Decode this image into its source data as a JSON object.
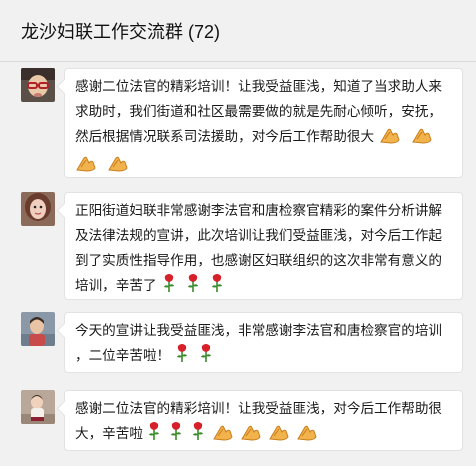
{
  "header": {
    "title": "龙沙妇联工作交流群 (72)"
  },
  "icons": {
    "clap": "clapping-hands-icon",
    "rose": "rose-icon"
  },
  "messages": [
    {
      "lines": [
        "感谢二位法官的精彩培训！让我受益匪浅，知道了当求助人来",
        "求助时，我们街道和社区最需要做的就是先耐心倾听，安抚，",
        "然后根据情况联系司法援助，对今后工作帮助很大"
      ],
      "emoji_line3": [
        "clap",
        "clap"
      ],
      "emoji_line4": [
        "clap",
        "clap"
      ]
    },
    {
      "lines": [
        "正阳街道妇联非常感谢李法官和唐检察官精彩的案件分析讲解",
        "及法律法规的宣讲，此次培训让我们受益匪浅，对今后工作起",
        "到了实质性指导作用，也感谢区妇联组织的这次非常有意义的",
        "培训，辛苦了"
      ],
      "emoji_line4": [
        "rose",
        "rose",
        "rose"
      ]
    },
    {
      "lines": [
        "今天的宣讲让我受益匪浅，非常感谢李法官和唐检察官的培训",
        "，二位辛苦啦！"
      ],
      "emoji_line2": [
        "rose",
        "rose"
      ]
    },
    {
      "lines": [
        "感谢二位法官的精彩培训！让我受益匪浅，对今后工作帮助很",
        "大，辛苦啦"
      ],
      "emoji_line2": [
        "rose",
        "rose",
        "rose",
        "clap",
        "clap",
        "clap",
        "clap"
      ]
    }
  ]
}
